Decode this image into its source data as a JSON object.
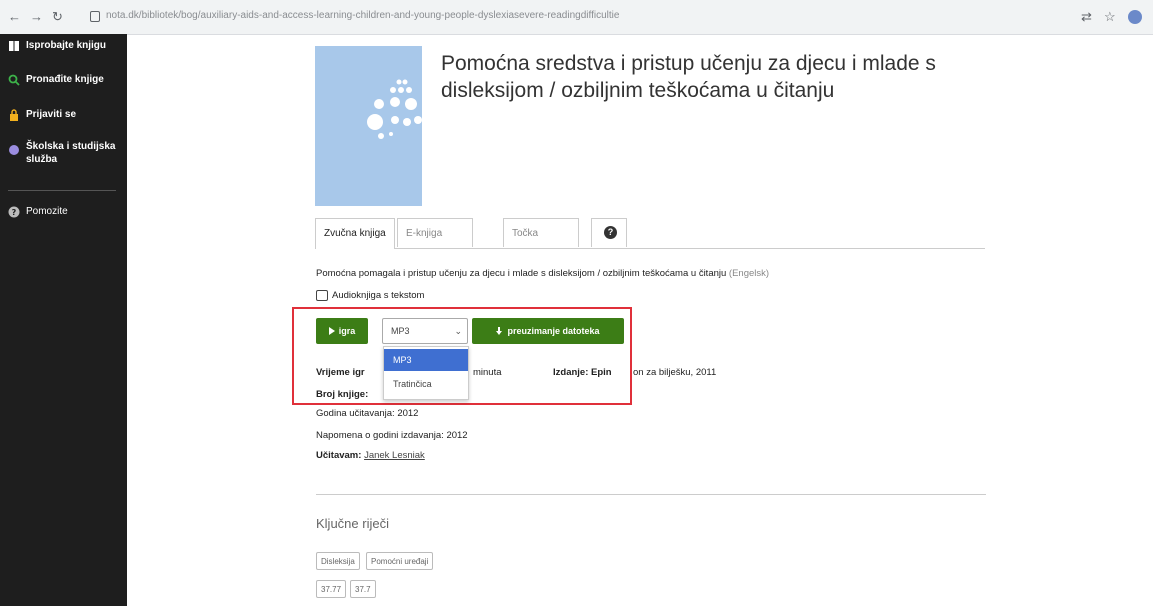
{
  "browser": {
    "url": "nota.dk/bibliotek/bog/auxiliary-aids-and-access-learning-children-and-young-people-dyslexiasevere-readingdifficultie"
  },
  "sidebar": {
    "items": [
      {
        "label": "Isprobajte knjigu",
        "icon": "book-icon"
      },
      {
        "label": "Pronađite knjige",
        "icon": "search-icon"
      },
      {
        "label": "Prijaviti se",
        "icon": "lock-icon"
      },
      {
        "label": "Školska i studijska služba",
        "icon": "circle-icon"
      },
      {
        "label": "Pomozite",
        "icon": "help-icon"
      }
    ]
  },
  "book": {
    "title": "Pomoćna sredstva i pristup učenju za djecu i mlade s disleksijom / ozbiljnim teškoćama u čitanju"
  },
  "tabs": [
    {
      "label": "Zvučna knjiga"
    },
    {
      "label": "E-knjiga"
    },
    {
      "label": "Točka"
    }
  ],
  "description": {
    "text": "Pomoćna pomagala i pristup učenju za djecu i mlade s disleksijom / ozbiljnim teškoćama u čitanju",
    "lang": "(Engelsk)"
  },
  "format": "Audioknjiga s tekstom",
  "controls": {
    "play_label": "igra",
    "select_value": "MP3",
    "download_label": "preuzimanje datoteka",
    "options": [
      "MP3",
      "Tratinčica"
    ]
  },
  "meta": {
    "playtime_label": "Vrijeme igr",
    "playtime_suffix": "minuta",
    "edition": "Izdanje: Epin",
    "edition_tail": "on za bilješku, 2011",
    "book_number_label": "Broj knjige:",
    "read_year": "Godina učitavanja: 2012",
    "note_year": "Napomena o godini izdavanja: 2012",
    "reader_label": "Učitavam:",
    "reader_name": "Janek Lesniak"
  },
  "keywords": {
    "title": "Ključne riječi",
    "items": [
      "Disleksija",
      "Pomoćni uređaji",
      "37.77",
      "37.7"
    ]
  },
  "colors": {
    "accent_green": "#3c7d16",
    "highlight_red": "#e0303a",
    "sidebar_bg": "#1e1e1e",
    "cover_bg": "#a8c8ea",
    "selected_option": "#3f6fd1"
  }
}
